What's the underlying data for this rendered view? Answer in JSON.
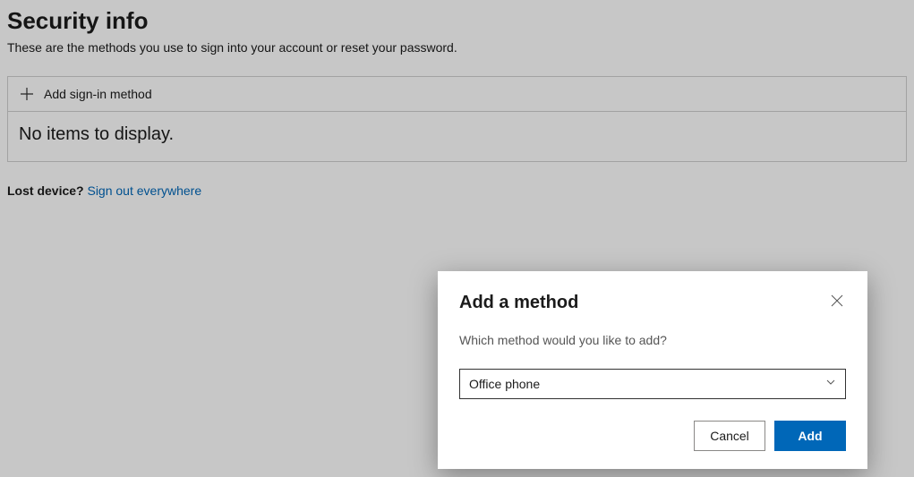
{
  "header": {
    "title": "Security info",
    "subtitle": "These are the methods you use to sign into your account or reset your password."
  },
  "methods": {
    "add_label": "Add sign-in method",
    "empty_text": "No items to display."
  },
  "lost_device": {
    "label": "Lost device?",
    "link": "Sign out everywhere"
  },
  "dialog": {
    "title": "Add a method",
    "subtitle": "Which method would you like to add?",
    "selected": "Office phone",
    "cancel": "Cancel",
    "add": "Add"
  }
}
